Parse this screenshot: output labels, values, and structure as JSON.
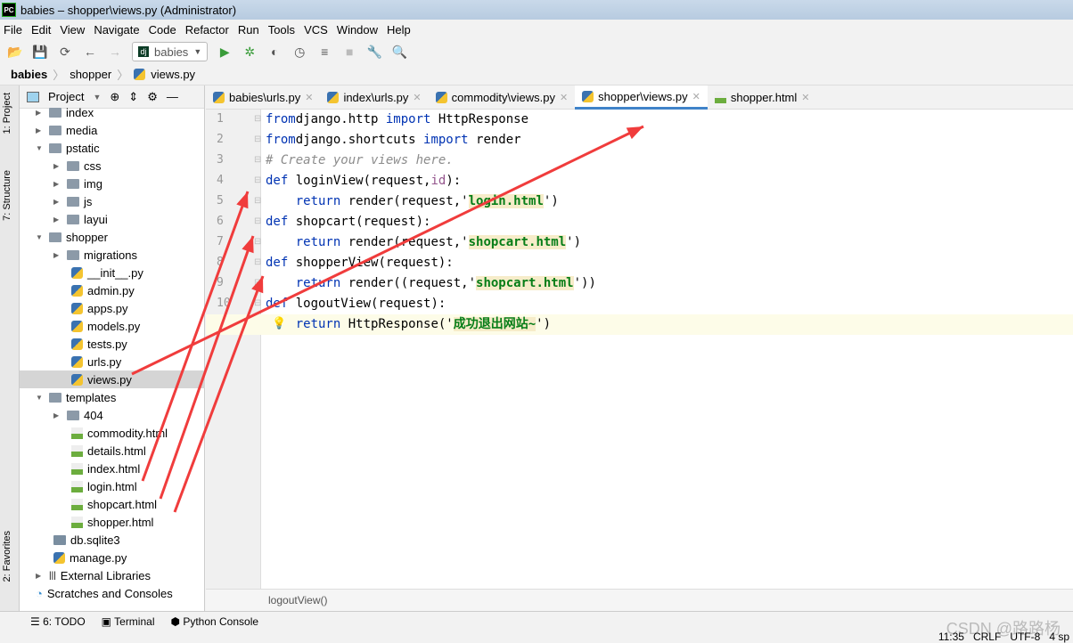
{
  "window": {
    "title": "babies – shopper\\views.py (Administrator)",
    "app_icon": "PC"
  },
  "menu": [
    "File",
    "Edit",
    "View",
    "Navigate",
    "Code",
    "Refactor",
    "Run",
    "Tools",
    "VCS",
    "Window",
    "Help"
  ],
  "toolbar": {
    "run_config": "babies"
  },
  "breadcrumb": [
    "babies",
    "shopper",
    "views.py"
  ],
  "left_strip": {
    "project": "1: Project",
    "structure": "7: Structure",
    "favorites": "2: Favorites"
  },
  "project_panel": {
    "title": "Project",
    "tree": [
      {
        "label": "index",
        "type": "folder",
        "depth": 1
      },
      {
        "label": "media",
        "type": "folder",
        "depth": 1
      },
      {
        "label": "pstatic",
        "type": "folder",
        "depth": 1,
        "open": true
      },
      {
        "label": "css",
        "type": "folder",
        "depth": 2
      },
      {
        "label": "img",
        "type": "folder",
        "depth": 2
      },
      {
        "label": "js",
        "type": "folder",
        "depth": 2
      },
      {
        "label": "layui",
        "type": "folder",
        "depth": 2
      },
      {
        "label": "shopper",
        "type": "folder",
        "depth": 1,
        "open": true
      },
      {
        "label": "migrations",
        "type": "folder",
        "depth": 2
      },
      {
        "label": "__init__.py",
        "type": "py",
        "depth": 3
      },
      {
        "label": "admin.py",
        "type": "py",
        "depth": 3
      },
      {
        "label": "apps.py",
        "type": "py",
        "depth": 3
      },
      {
        "label": "models.py",
        "type": "py",
        "depth": 3
      },
      {
        "label": "tests.py",
        "type": "py",
        "depth": 3
      },
      {
        "label": "urls.py",
        "type": "py",
        "depth": 3
      },
      {
        "label": "views.py",
        "type": "py",
        "depth": 3,
        "selected": true
      },
      {
        "label": "templates",
        "type": "folder",
        "depth": 1,
        "open": true
      },
      {
        "label": "404",
        "type": "folder",
        "depth": 2
      },
      {
        "label": "commodity.html",
        "type": "html",
        "depth": 3
      },
      {
        "label": "details.html",
        "type": "html",
        "depth": 3
      },
      {
        "label": "index.html",
        "type": "html",
        "depth": 3
      },
      {
        "label": "login.html",
        "type": "html",
        "depth": 3
      },
      {
        "label": "shopcart.html",
        "type": "html",
        "depth": 3
      },
      {
        "label": "shopper.html",
        "type": "html",
        "depth": 3
      },
      {
        "label": "db.sqlite3",
        "type": "db",
        "depth": 2
      },
      {
        "label": "manage.py",
        "type": "py",
        "depth": 2
      },
      {
        "label": "External Libraries",
        "type": "lib",
        "depth": 0
      },
      {
        "label": "Scratches and Consoles",
        "type": "scratch",
        "depth": 0
      }
    ]
  },
  "tabs": [
    {
      "label": "babies\\urls.py",
      "icon": "py"
    },
    {
      "label": "index\\urls.py",
      "icon": "py"
    },
    {
      "label": "commodity\\views.py",
      "icon": "py"
    },
    {
      "label": "shopper\\views.py",
      "icon": "py",
      "active": true
    },
    {
      "label": "shopper.html",
      "icon": "html"
    }
  ],
  "code": [
    [
      [
        "kw",
        "from"
      ],
      [
        "",
        "django.http "
      ],
      [
        "kw",
        "import"
      ],
      [
        "",
        " HttpResponse"
      ]
    ],
    [
      [
        "kw",
        "from"
      ],
      [
        "",
        "django.shortcuts "
      ],
      [
        "kw",
        "import"
      ],
      [
        "",
        " render"
      ]
    ],
    [
      [
        "cm",
        "# Create your views here."
      ]
    ],
    [
      [
        "kw",
        "def"
      ],
      [
        "",
        " loginView(request,"
      ],
      [
        "pa",
        "id"
      ],
      [
        "",
        "):"
      ]
    ],
    [
      [
        "",
        "    "
      ],
      [
        "kw",
        "return"
      ],
      [
        "",
        " render(request,'"
      ],
      [
        "st",
        "login.html"
      ],
      [
        "",
        "')"
      ]
    ],
    [
      [
        "kw",
        "def"
      ],
      [
        "",
        " shopcart(request):"
      ]
    ],
    [
      [
        "",
        "    "
      ],
      [
        "kw",
        "return"
      ],
      [
        "",
        " render(request,'"
      ],
      [
        "st",
        "shopcart.html"
      ],
      [
        "",
        "')"
      ]
    ],
    [
      [
        "kw",
        "def"
      ],
      [
        "",
        " shopperView(request):"
      ]
    ],
    [
      [
        "",
        "    "
      ],
      [
        "kw",
        "return"
      ],
      [
        "",
        " render((request,'"
      ],
      [
        "st",
        "shopcart.html"
      ],
      [
        "",
        "'))"
      ]
    ],
    [
      [
        "kw",
        "def"
      ],
      [
        "",
        " logoutView(request):"
      ]
    ],
    [
      [
        "",
        "    "
      ],
      [
        "kw",
        "return"
      ],
      [
        "",
        " HttpResponse('"
      ],
      [
        "st",
        "成功退出网站~"
      ],
      [
        "",
        "')"
      ]
    ]
  ],
  "editor_breadcrumb": "logoutView()",
  "bottom_tabs": [
    "6: TODO",
    "Terminal",
    "Python Console"
  ],
  "status": {
    "position": "11:35",
    "line_sep": "CRLF",
    "encoding": "UTF-8",
    "indent": "4 sp"
  },
  "watermark": "CSDN @路路杨",
  "annotation_color": "#f03c3c"
}
